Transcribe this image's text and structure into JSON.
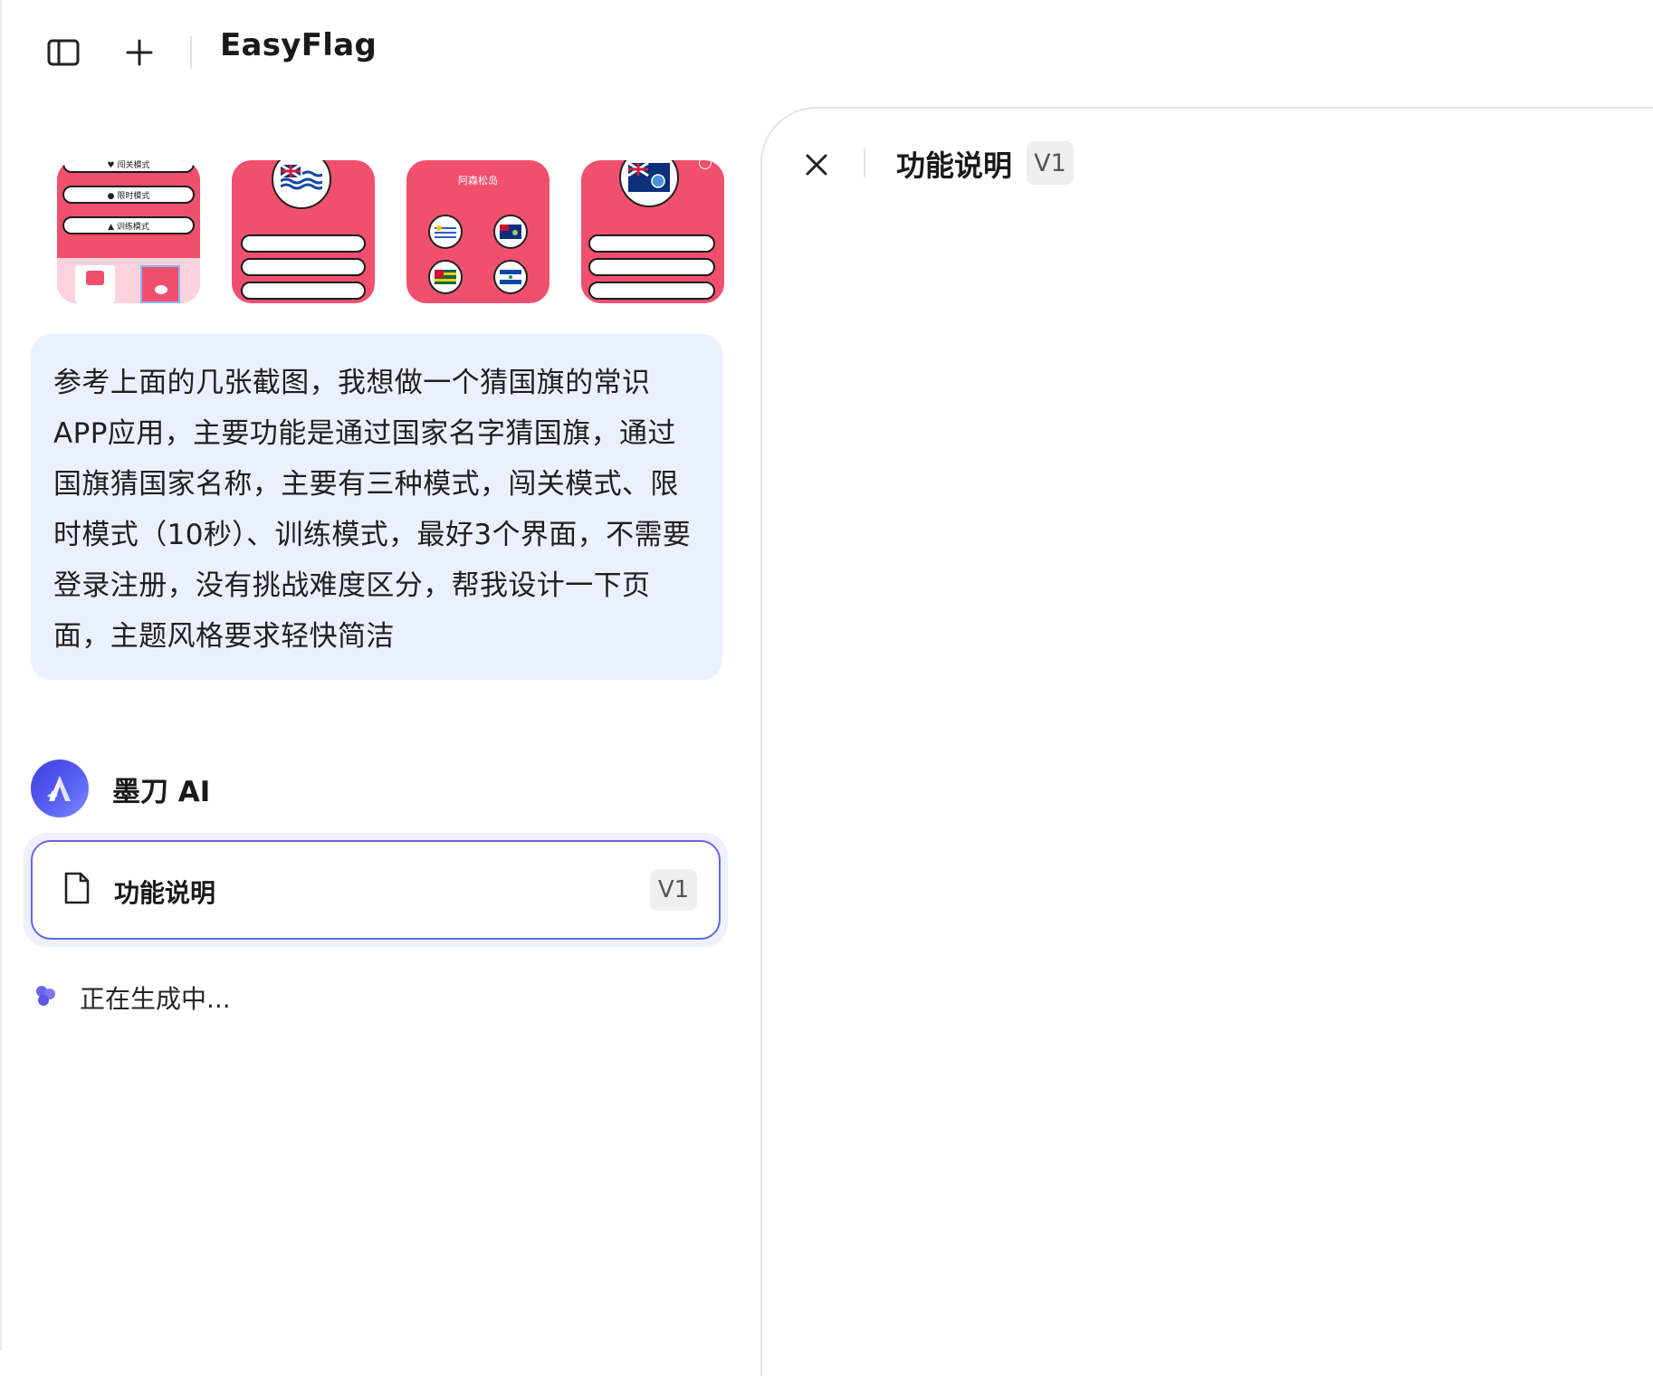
{
  "header": {
    "title": "EasyFlag"
  },
  "thumbnails": {
    "t1_buttons": [
      "闯关模式",
      "限时模式",
      "训练模式"
    ],
    "t3_caption": "阿森松岛"
  },
  "message": {
    "user_text": "参考上面的几张截图，我想做一个猜国旗的常识APP应用，主要功能是通过国家名字猜国旗，通过国旗猜国家名称，主要有三种模式，闯关模式、限时模式（10秒）、训练模式，最好3个界面，不需要登录注册，没有挑战难度区分，帮我设计一下页面，主题风格要求轻快简洁"
  },
  "assistant": {
    "name": "墨刀 AI",
    "doc_title": "功能说明",
    "doc_version": "V1",
    "status": "正在生成中..."
  },
  "panel": {
    "title": "功能说明",
    "version": "V1"
  },
  "colors": {
    "accent": "#6166e6",
    "thumb_pink": "#f0506e",
    "bubble_bg": "#ebf0fe"
  }
}
